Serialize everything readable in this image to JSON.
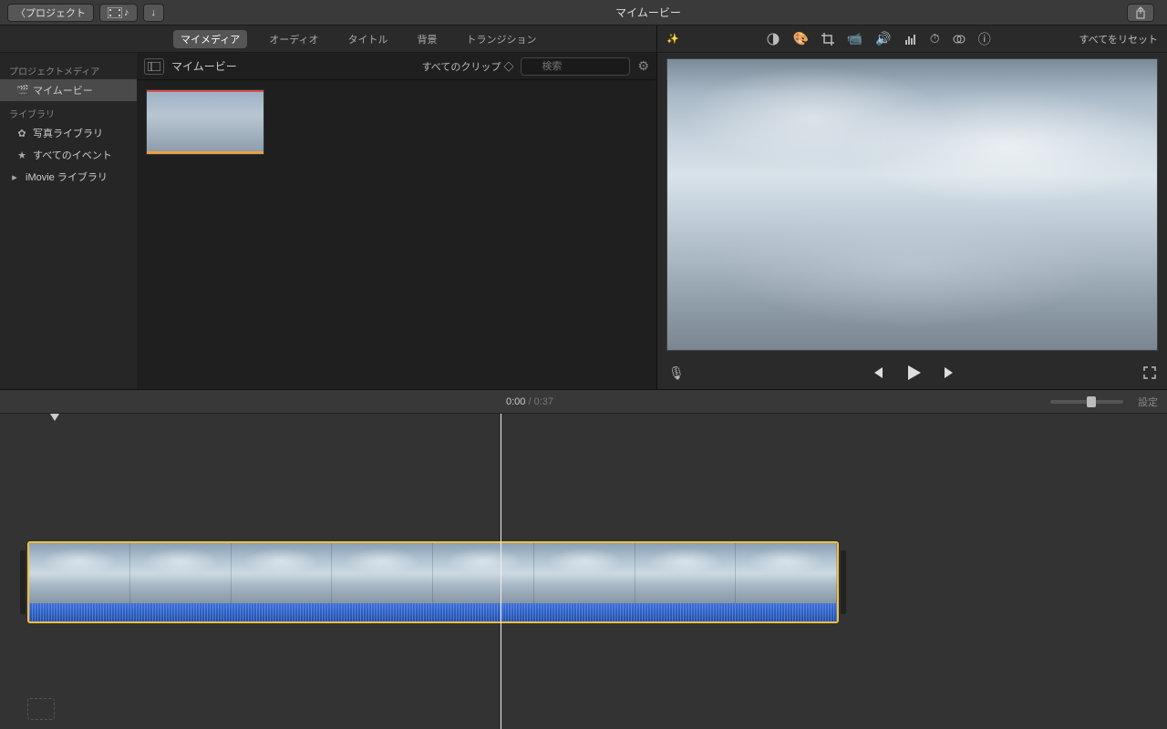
{
  "titlebar": {
    "back_label": "プロジェクト",
    "title": "マイムービー"
  },
  "tabs": {
    "my_media": "マイメディア",
    "audio": "オーディオ",
    "titles": "タイトル",
    "backgrounds": "背景",
    "transitions": "トランジション"
  },
  "sidebar": {
    "project_media_hdr": "プロジェクトメディア",
    "my_movie": "マイムービー",
    "library_hdr": "ライブラリ",
    "photo_library": "写真ライブラリ",
    "all_events": "すべてのイベント",
    "imovie_library": "iMovie ライブラリ"
  },
  "clipbar": {
    "title": "マイムービー",
    "filter": "すべてのクリップ",
    "search_placeholder": "検索"
  },
  "adjust": {
    "reset": "すべてをリセット"
  },
  "timecode": {
    "current": "0:00",
    "sep": " / ",
    "duration": "0:37"
  },
  "timeline": {
    "settings": "設定"
  }
}
